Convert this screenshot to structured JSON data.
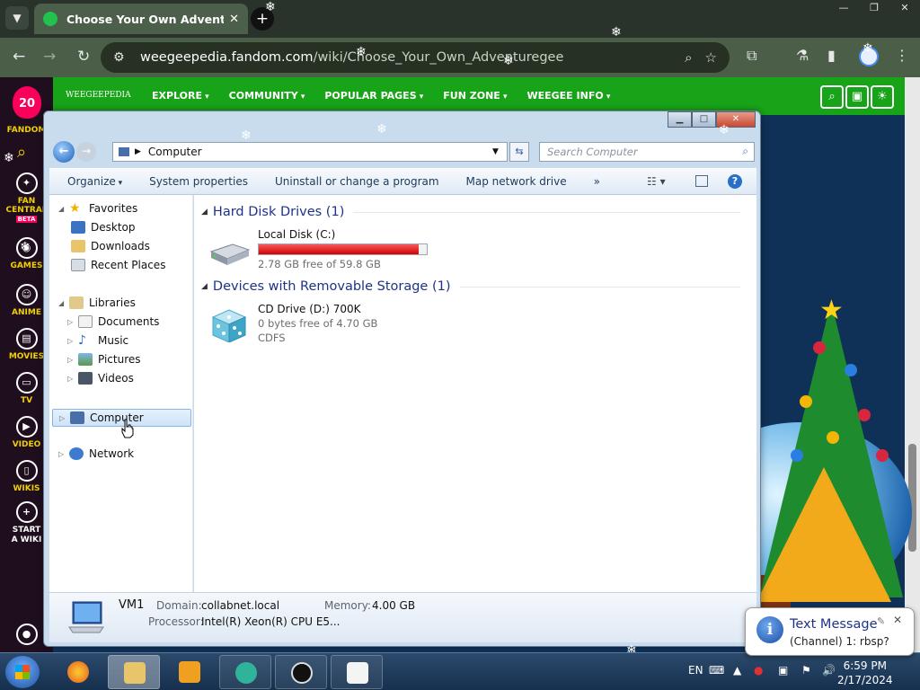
{
  "browser": {
    "tab_title": "Choose Your Own Adventure",
    "url_domain": "weegeepedia.fandom.com",
    "url_path": "/wiki/Choose_Your_Own_Adventuregee"
  },
  "fandom_rail": {
    "logo_text": "20",
    "fandom_label": "FANDOM",
    "items": [
      {
        "label": "FAN CENTRAL",
        "badge": "BETA"
      },
      {
        "label": "GAMES"
      },
      {
        "label": "ANIME"
      },
      {
        "label": "MOVIES"
      },
      {
        "label": "TV"
      },
      {
        "label": "VIDEO"
      },
      {
        "label": "WIKIS"
      },
      {
        "label": "START A WIKI"
      }
    ]
  },
  "wiki": {
    "brand": "WEEGEEPEDIA",
    "menu": [
      "EXPLORE",
      "COMMUNITY",
      "POPULAR PAGES",
      "FUN ZONE",
      "WEEGEE INFO"
    ]
  },
  "explorer": {
    "address": "Computer",
    "search_placeholder": "Search Computer",
    "commands": [
      "Organize",
      "System properties",
      "Uninstall or change a program",
      "Map network drive"
    ],
    "more": "»",
    "nav": {
      "favorites": "Favorites",
      "desktop": "Desktop",
      "downloads": "Downloads",
      "recent": "Recent Places",
      "libraries": "Libraries",
      "documents": "Documents",
      "music": "Music",
      "pictures": "Pictures",
      "videos": "Videos",
      "computer": "Computer",
      "network": "Network"
    },
    "groups": [
      {
        "title": "Hard Disk Drives (1)"
      },
      {
        "title": "Devices with Removable Storage (1)"
      }
    ],
    "drives": [
      {
        "name": "Local Disk (C:)",
        "free": "2.78 GB free of 59.8 GB",
        "used_fraction": 0.95
      },
      {
        "name": "CD Drive (D:) 700K",
        "free": "0 bytes free of 4.70 GB",
        "fs": "CDFS"
      }
    ],
    "details": {
      "name": "VM1",
      "domain_label": "Domain:",
      "domain": "collabnet.local",
      "memory_label": "Memory:",
      "memory": "4.00 GB",
      "processor_label": "Processor:",
      "processor": "Intel(R) Xeon(R) CPU E5..."
    }
  },
  "taskbar": {
    "lang": "EN",
    "time": "6:59 PM",
    "date": "2/17/2024"
  },
  "notification": {
    "title": "Text Message",
    "body": "(Channel) 1: rbsp?"
  }
}
